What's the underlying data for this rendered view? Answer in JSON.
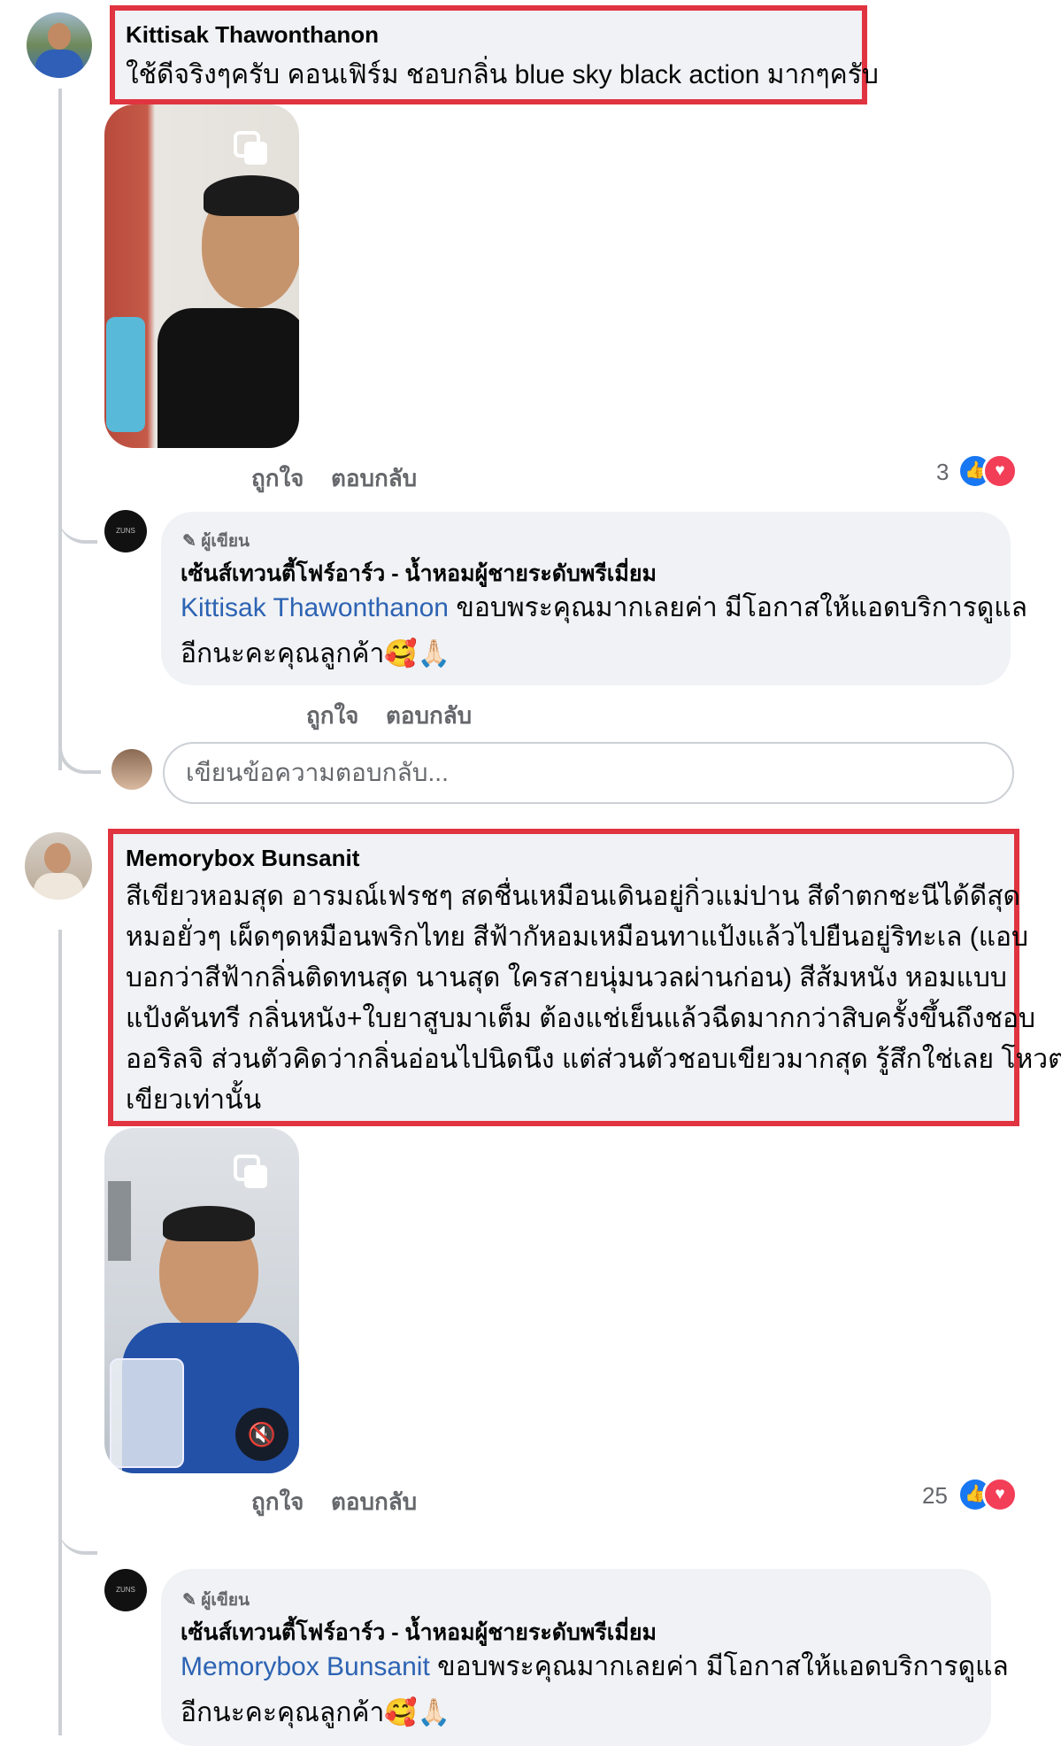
{
  "comments": [
    {
      "author": "Kittisak Thawonthanon",
      "text": "ใช้ดีจริงๆครับ คอนเฟิร์ม ชอบกลิ่น blue sky black action มากๆครับ",
      "like_label": "ถูกใจ",
      "reply_label": "ตอบกลับ",
      "reaction_count": "3",
      "reply": {
        "badge": "ผู้เขียน",
        "page_name": "เซ้นส์เทวนตี้โฟร์อาร์ว - น้ำหอมผู้ชายระดับพรีเมี่ยม",
        "mention": "Kittisak Thawonthanon",
        "line1": " ขอบพระคุณมากเลยค่า มีโอกาสให้แอดบริการดูแล",
        "line2": "อีกนะคะคุณลูกค้า🥰🙏🏻",
        "like_label": "ถูกใจ",
        "reply_label": "ตอบกลับ"
      },
      "reply_placeholder": "เขียนข้อความตอบกลับ..."
    },
    {
      "author": "Memorybox Bunsanit",
      "lines": [
        "สีเขียวหอมสุด อารมณ์เฟรชๆ สดชื่นเหมือนเดินอยู่กิ่วแม่ปาน สีดำตกชะนีได้ดีสุด",
        "หมอยั่วๆ เผ็ดๆดหมือนพริกไทย สีฟ้ากัหอมเหมือนทาแป้งแล้วไปยืนอยู่ริทะเล (แอบ",
        "บอกว่าสีฟ้ากลิ่นติดทนสุด นานสุด ใครสายนุ่มนวลผ่านก่อน)  สีส้มหนัง หอมแบบ",
        "แป้งคันทรี กลิ่นหนัง+ใบยาสูบมาเต็ม ต้องแช่เย็นแล้วฉีดมากกว่าสิบครั้งขึ้นถึงชอบ",
        "ออริลจิ ส่วนตัวคิดว่ากลิ่นอ่อนไปนิดนึง แต่ส่วนตัวชอบเขียวมากสุด รู้สึกใช่เลย โหวต",
        "เขียวเท่านั้น"
      ],
      "like_label": "ถูกใจ",
      "reply_label": "ตอบกลับ",
      "reaction_count": "25",
      "reply": {
        "badge": "ผู้เขียน",
        "page_name": "เซ้นส์เทวนตี้โฟร์อาร์ว - น้ำหอมผู้ชายระดับพรีเมี่ยม",
        "mention": "Memorybox Bunsanit",
        "line1": " ขอบพระคุณมากเลยค่า มีโอกาสให้แอดบริการดูแล",
        "line2": "อีกนะคะคุณลูกค้า🥰🙏🏻"
      }
    }
  ],
  "colors": {
    "highlight": "#e03440",
    "bubble": "#f0f2f5",
    "link": "#2d63b3",
    "like": "#1877f2",
    "love": "#f33e58"
  },
  "icons": [
    "copy-icon",
    "mute-icon",
    "like-reaction-icon",
    "love-reaction-icon",
    "pencil-icon"
  ]
}
